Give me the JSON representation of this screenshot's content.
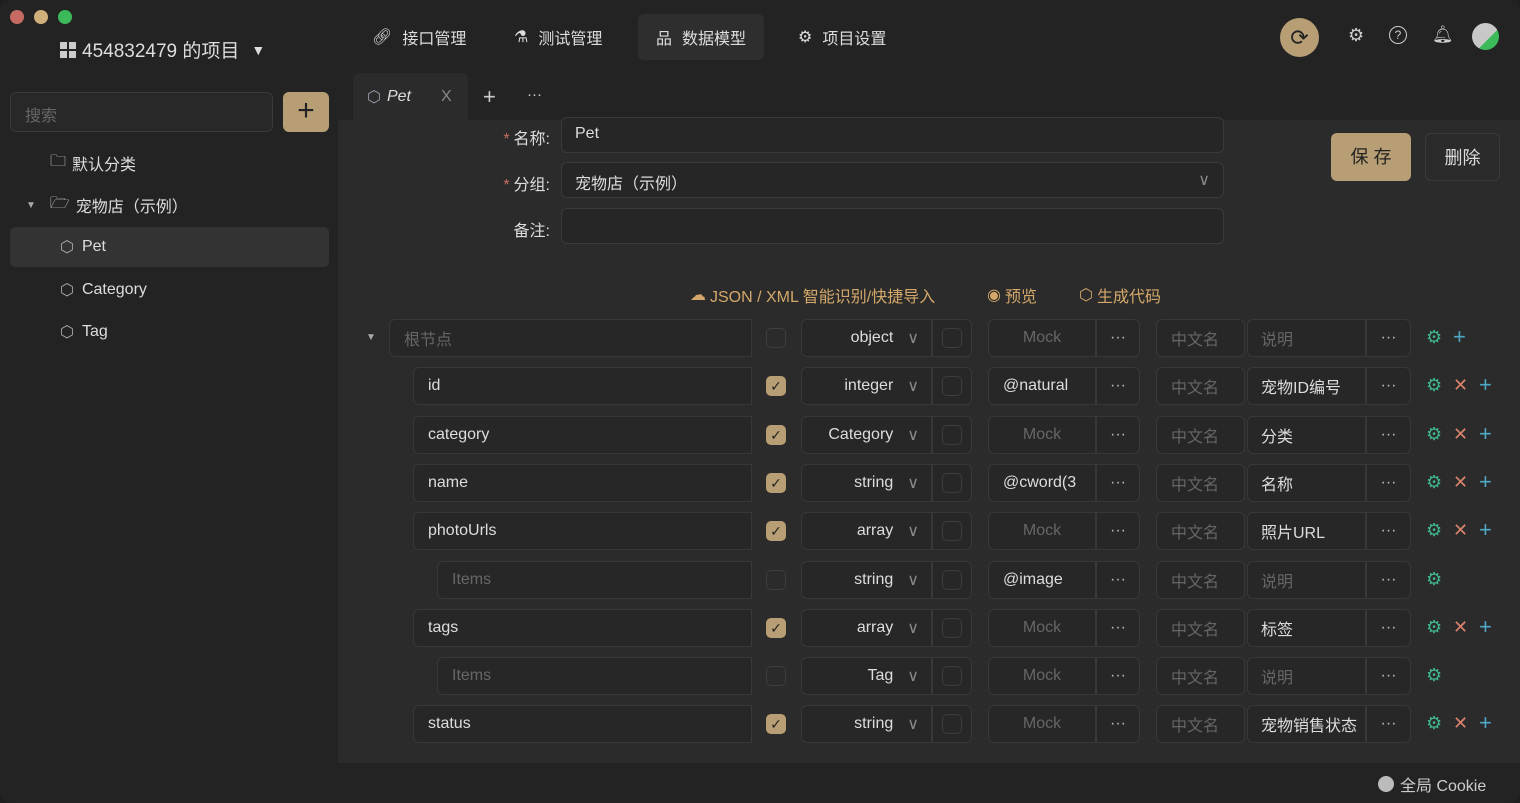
{
  "window": {
    "controls": [
      "close",
      "minimize",
      "maximize"
    ]
  },
  "project": {
    "title": "454832479 的项目"
  },
  "sidebar": {
    "search_placeholder": "搜索",
    "add_label": "+",
    "items": [
      {
        "label": "默认分类",
        "icon": "folder-icon",
        "level": 0
      },
      {
        "label": "宠物店（示例）",
        "icon": "folder-open-icon",
        "level": 0
      },
      {
        "label": "Pet",
        "icon": "cube-icon",
        "level": 1,
        "active": true
      },
      {
        "label": "Category",
        "icon": "cube-icon",
        "level": 1
      },
      {
        "label": "Tag",
        "icon": "cube-icon",
        "level": 1
      }
    ]
  },
  "topnav": [
    {
      "label": "接口管理",
      "icon": "link-icon"
    },
    {
      "label": "测试管理",
      "icon": "flask-icon"
    },
    {
      "label": "数据模型",
      "icon": "model-icon",
      "active": true
    },
    {
      "label": "项目设置",
      "icon": "gear-icon"
    }
  ],
  "tabs": {
    "active": "Pet",
    "close": "X",
    "add": "+",
    "more": "···"
  },
  "form": {
    "name_label": "名称:",
    "name_value": "Pet",
    "group_label": "分组:",
    "group_value": "宠物店（示例）",
    "note_label": "备注:",
    "note_value": "",
    "save": "保 存",
    "delete": "删除"
  },
  "toolbar": {
    "import": "JSON / XML 智能识别/快捷导入",
    "preview": "预览",
    "generate": "生成代码"
  },
  "schema_rows": [
    {
      "name": "根节点",
      "placeholder": true,
      "level": 0,
      "required": false,
      "type": "object",
      "mock": "Mock",
      "mock_ph": true,
      "cn": "中文名",
      "desc": "说明",
      "desc_ph": true,
      "actions": [
        "gear",
        "add"
      ]
    },
    {
      "name": "id",
      "level": 1,
      "required": true,
      "type": "integer",
      "mock": "@natural",
      "cn": "中文名",
      "desc": "宠物ID编号",
      "actions": [
        "gear",
        "delete",
        "add"
      ]
    },
    {
      "name": "category",
      "level": 1,
      "required": true,
      "type": "Category",
      "mock": "Mock",
      "mock_ph": true,
      "cn": "中文名",
      "desc": "分类",
      "actions": [
        "gear",
        "delete",
        "add"
      ]
    },
    {
      "name": "name",
      "level": 1,
      "required": true,
      "type": "string",
      "mock": "@cword(3",
      "cn": "中文名",
      "desc": "名称",
      "actions": [
        "gear",
        "delete",
        "add"
      ]
    },
    {
      "name": "photoUrls",
      "level": 1,
      "required": true,
      "type": "array",
      "mock": "Mock",
      "mock_ph": true,
      "cn": "中文名",
      "desc": "照片URL",
      "actions": [
        "gear",
        "delete",
        "add"
      ]
    },
    {
      "name": "Items",
      "placeholder": true,
      "level": 2,
      "required": false,
      "type": "string",
      "mock": "@image",
      "cn": "中文名",
      "desc": "说明",
      "desc_ph": true,
      "actions": [
        "gear"
      ]
    },
    {
      "name": "tags",
      "level": 1,
      "required": true,
      "type": "array",
      "mock": "Mock",
      "mock_ph": true,
      "cn": "中文名",
      "desc": "标签",
      "actions": [
        "gear",
        "delete",
        "add"
      ]
    },
    {
      "name": "Items",
      "placeholder": true,
      "level": 2,
      "required": false,
      "type": "Tag",
      "mock": "Mock",
      "mock_ph": true,
      "cn": "中文名",
      "desc": "说明",
      "desc_ph": true,
      "actions": [
        "gear"
      ]
    },
    {
      "name": "status",
      "level": 1,
      "required": true,
      "type": "string",
      "mock": "Mock",
      "mock_ph": true,
      "cn": "中文名",
      "desc": "宠物销售状态",
      "actions": [
        "gear",
        "delete",
        "add"
      ]
    }
  ],
  "watermark": "全局 Cookie",
  "colors": {
    "accent": "#b79e74",
    "link": "#d4a86a",
    "gear": "#3fb68b",
    "delete": "#d9826b",
    "add": "#4fa8c4"
  }
}
